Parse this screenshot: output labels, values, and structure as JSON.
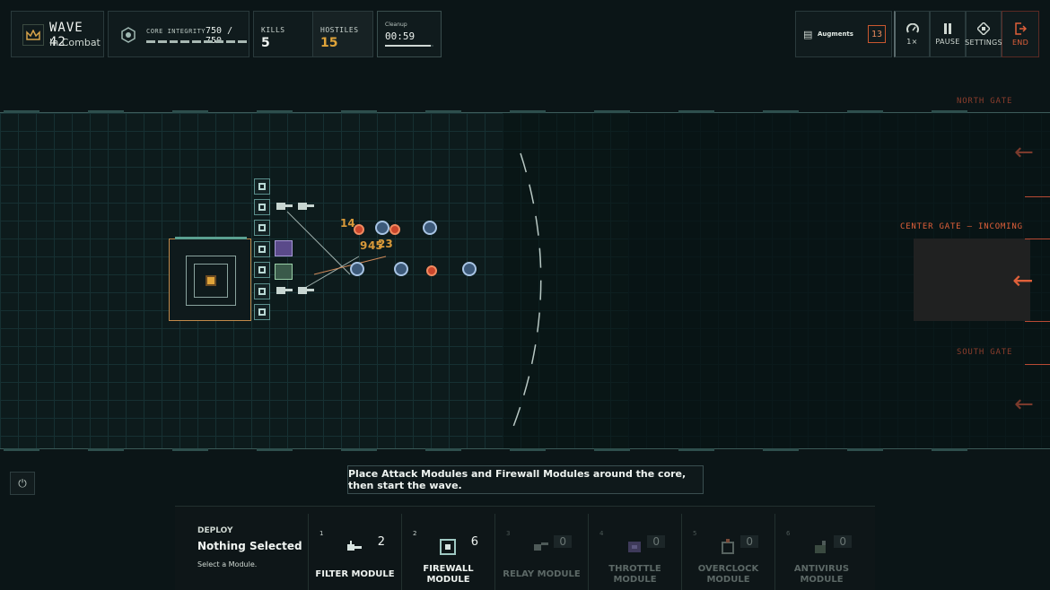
{
  "hud": {
    "wave_label": "WAVE 42",
    "wave_status": "In Combat",
    "core_label": "CORE INTEGRITY",
    "core_value": "750 / 750",
    "core_fraction": 1.0,
    "kills_label": "KILLS",
    "kills_value": "5",
    "hostiles_label": "HOSTILES",
    "hostiles_value": "15",
    "cleanup_label": "Cleanup",
    "cleanup_timer": "00:59",
    "cleanup_fraction": 0.95
  },
  "controls": {
    "augments_label": "Augments",
    "augments_count": "13",
    "speed_label": "1×",
    "pause_label": "PAUSE",
    "settings_label": "SETTINGS",
    "end_label": "END"
  },
  "arena": {
    "gates": {
      "north": "NORTH GATE",
      "center": "CENTER GATE — INCOMING",
      "south": "SOUTH GATE"
    },
    "damage_numbers": [
      "14",
      "9",
      "45",
      "23"
    ]
  },
  "hint": "Place Attack Modules and Firewall Modules around the core, then start the wave.",
  "deploy": {
    "heading": "DEPLOY",
    "selection": "Nothing Selected",
    "instruction": "Select a Module.",
    "modules": [
      {
        "key": "1",
        "name": "FILTER MODULE",
        "count": "2"
      },
      {
        "key": "2",
        "name": "FIREWALL MODULE",
        "count": "6"
      },
      {
        "key": "3",
        "name": "RELAY MODULE",
        "count": "0"
      },
      {
        "key": "4",
        "name": "THROTTLE MODULE",
        "count": "0"
      },
      {
        "key": "5",
        "name": "OVERCLOCK MODULE",
        "count": "0"
      },
      {
        "key": "6",
        "name": "ANTIVIRUS MODULE",
        "count": "0"
      }
    ]
  },
  "colors": {
    "accent_orange": "#e0603a",
    "core_gold": "#e0a43a",
    "enemy_red": "#c9462c",
    "enemy_blue": "#3d5a7a",
    "grid": "#163032"
  }
}
